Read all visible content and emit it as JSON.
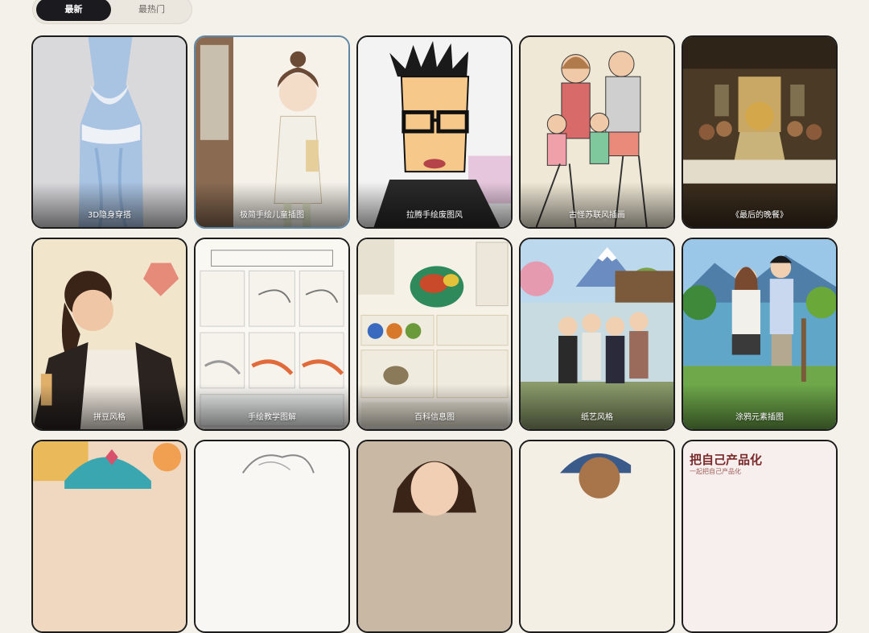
{
  "tabs": [
    {
      "label": "最新",
      "active": true
    },
    {
      "label": "最热门",
      "active": false
    }
  ],
  "cards": [
    {
      "caption": "3D隐身穿搭"
    },
    {
      "caption": "极简手绘儿童插图"
    },
    {
      "caption": "拉腾手绘废图风"
    },
    {
      "caption": "古怪苏联风插画"
    },
    {
      "caption": "《最后的晚餐》"
    },
    {
      "caption": "拼豆风格"
    },
    {
      "caption": "手绘教学图解"
    },
    {
      "caption": "百科信息图"
    },
    {
      "caption": "纸艺风格"
    },
    {
      "caption": "涂鸦元素插图"
    }
  ],
  "partial_cards": [
    {
      "overlay_title": "",
      "overlay_sub": ""
    },
    {
      "overlay_title": "",
      "overlay_sub": ""
    },
    {
      "overlay_title": "",
      "overlay_sub": ""
    },
    {
      "overlay_title": "",
      "overlay_sub": ""
    },
    {
      "overlay_title": "把自己产品化",
      "overlay_sub": "一起把自己产品化"
    }
  ]
}
